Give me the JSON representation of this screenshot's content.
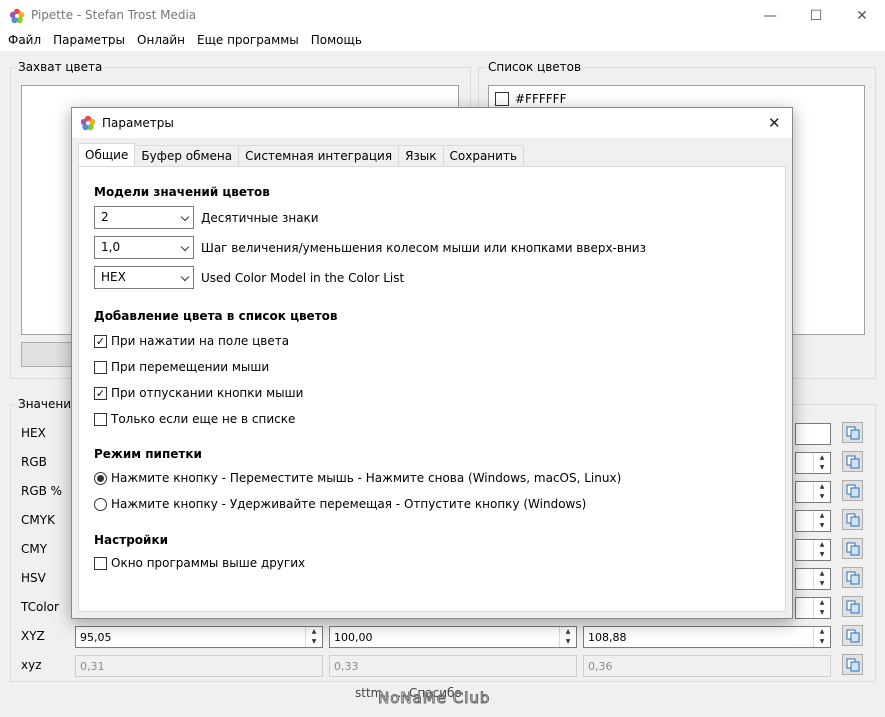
{
  "window": {
    "title": "Pipette - Stefan Trost Media",
    "minimize": "—",
    "maximize": "☐",
    "close": "✕"
  },
  "menu": [
    "Файл",
    "Параметры",
    "Онлайн",
    "Еще программы",
    "Помощь"
  ],
  "capture": {
    "label": "Захват цвета"
  },
  "colorlist": {
    "label": "Список цветов",
    "items": [
      {
        "hex": "#FFFFFF",
        "color": "#FFFFFF"
      }
    ]
  },
  "values": {
    "label": "Значения",
    "rows": [
      {
        "name": "HEX"
      },
      {
        "name": "RGB"
      },
      {
        "name": "RGB %"
      },
      {
        "name": "CMYK"
      },
      {
        "name": "CMY"
      },
      {
        "name": "HSV"
      },
      {
        "name": "TColor"
      },
      {
        "name": "XYZ",
        "v1": "95,05",
        "v2": "100,00",
        "v3": "108,88"
      },
      {
        "name": "xyz",
        "v1": "0,31",
        "v2": "0,33",
        "v3": "0,36"
      }
    ]
  },
  "footer": {
    "text": "sttm... ...Спасибо",
    "watermark": "NoNaMe Club"
  },
  "dialog": {
    "title": "Параметры",
    "close": "✕",
    "tabs": [
      "Общие",
      "Буфер обмена",
      "Системная интеграция",
      "Язык",
      "Сохранить"
    ],
    "section_models": "Модели значений цветов",
    "combos": [
      {
        "value": "2",
        "label": "Десятичные знаки"
      },
      {
        "value": "1,0",
        "label": "Шаг величения/уменьшения колесом мыши или кнопками вверх-вниз"
      },
      {
        "value": "HEX",
        "label": "Used Color Model in the Color List"
      }
    ],
    "section_add": "Добавление цвета в список цветов",
    "checks": [
      {
        "label": "При нажатии на поле цвета",
        "checked": true
      },
      {
        "label": "При перемещении мыши",
        "checked": false
      },
      {
        "label": "При отпускании кнопки мыши",
        "checked": true
      },
      {
        "label": "Только если еще не в списке",
        "checked": false
      }
    ],
    "section_mode": "Режим пипетки",
    "radios": [
      {
        "label": "Нажмите кнопку - Переместите мышь - Нажмите снова (Windows, macOS, Linux)",
        "selected": true
      },
      {
        "label": "Нажмите кнопку - Удерживайте перемещая - Отпустите кнопку (Windows)",
        "selected": false
      }
    ],
    "section_settings": "Настройки",
    "topmost": {
      "label": "Окно программы выше других",
      "checked": false
    }
  }
}
